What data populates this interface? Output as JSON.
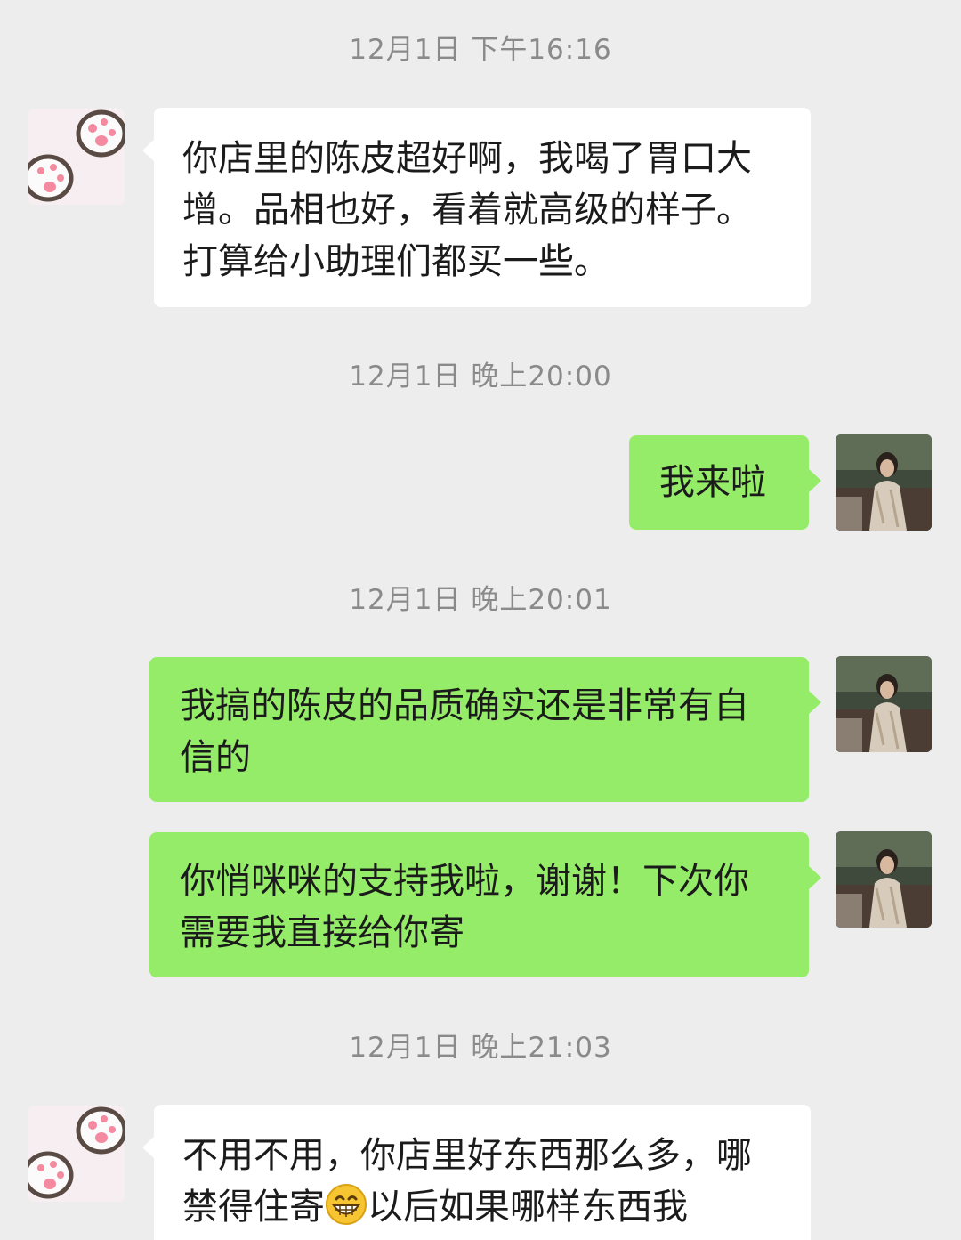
{
  "chat": {
    "timestamps": [
      "12月1日 下午16:16",
      "12月1日 晚上20:00",
      "12月1日 晚上20:01",
      "12月1日 晚上21:03"
    ],
    "messages": [
      {
        "side": "in",
        "text": "你店里的陈皮超好啊，我喝了胃口大增。品相也好，看着就高级的样子。打算给小助理们都买一些。"
      },
      {
        "side": "out",
        "text": "我来啦"
      },
      {
        "side": "out",
        "text": "我搞的陈皮的品质确实还是非常有自信的"
      },
      {
        "side": "out",
        "text": "你悄咪咪的支持我啦，谢谢！下次你需要我直接给你寄"
      },
      {
        "side": "in",
        "text_before_emoji": "不用不用，你店里好东西那么多，哪禁得住寄",
        "emoji": "grinning-face-emoji",
        "text_after_emoji": "以后如果哪样东西我"
      }
    ]
  },
  "avatars": {
    "contact": "paw-print-avatar",
    "self": "photo-avatar"
  },
  "colors": {
    "background": "#ededed",
    "incoming_bubble": "#ffffff",
    "outgoing_bubble": "#95ec69",
    "timestamp": "#8a8a8a"
  }
}
